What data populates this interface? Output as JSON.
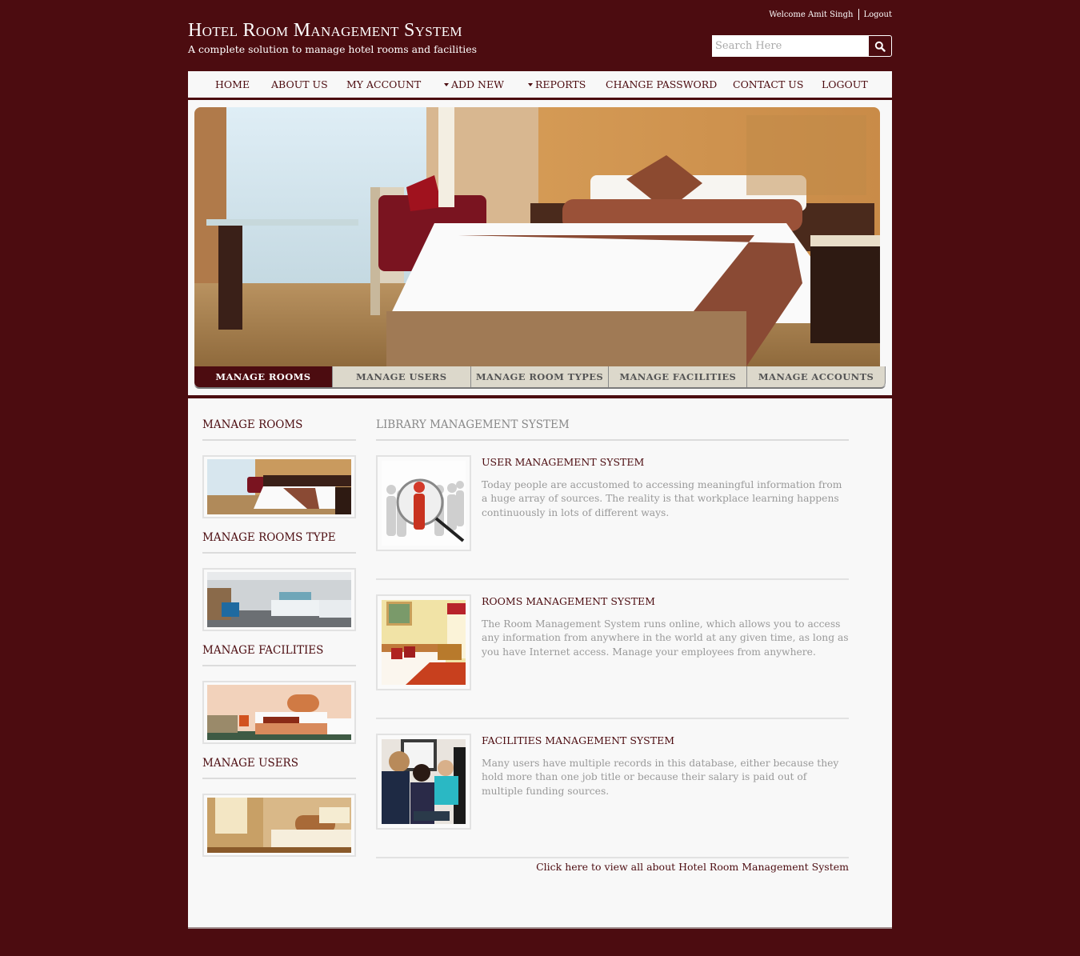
{
  "header": {
    "title": "Hotel Room Management System",
    "subtitle": "A complete solution to manage hotel rooms and facilities",
    "welcome": "Welcome Amit Singh",
    "logout": "Logout",
    "search_placeholder": "Search Here",
    "search_icon": "search-icon"
  },
  "nav": {
    "items": [
      {
        "label": "HOME",
        "dropdown": false
      },
      {
        "label": "ABOUT US",
        "dropdown": false
      },
      {
        "label": "MY ACCOUNT",
        "dropdown": false
      },
      {
        "label": "ADD NEW",
        "dropdown": true
      },
      {
        "label": "REPORTS",
        "dropdown": true
      },
      {
        "label": "CHANGE PASSWORD",
        "dropdown": false
      },
      {
        "label": "CONTACT US",
        "dropdown": false
      },
      {
        "label": "LOGOUT",
        "dropdown": false
      }
    ]
  },
  "hero": {
    "image": "hotel-room-photo",
    "tabs": [
      {
        "label": "MANAGE ROOMS",
        "active": true
      },
      {
        "label": "MANAGE USERS",
        "active": false
      },
      {
        "label": "MANAGE ROOM TYPES",
        "active": false
      },
      {
        "label": "MANAGE FACILITIES",
        "active": false
      },
      {
        "label": "MANAGE ACCOUNTS",
        "active": false
      }
    ]
  },
  "sidebar": {
    "sections": [
      {
        "heading": "MANAGE ROOMS",
        "image": "hotel-room-thumbnail"
      },
      {
        "heading": "MANAGE ROOMS TYPE",
        "image": "room-type-thumbnail"
      },
      {
        "heading": "MANAGE FACILITIES",
        "image": "facilities-thumbnail"
      },
      {
        "heading": "MANAGE USERS",
        "image": "users-thumbnail"
      }
    ]
  },
  "main": {
    "heading": "LIBRARY MANAGEMENT SYSTEM",
    "items": [
      {
        "title": "USER MANAGEMENT SYSTEM",
        "text": "Today people are accustomed to accessing meaningful information from a huge array of sources. The reality is that workplace learning happens continuously in lots of different ways.",
        "image": "user-search-magnifier-image"
      },
      {
        "title": "ROOMS MANAGEMENT SYSTEM",
        "text": "The Room Management System runs online, which allows you to access any information from anywhere in the world at any given time, as long as you have Internet access. Manage your employees from anywhere.",
        "image": "hotel-bedroom-image"
      },
      {
        "title": "FACILITIES MANAGEMENT SYSTEM",
        "text": "Many users have multiple records in this database, either because they hold more than one job title or because their salary is paid out of multiple funding sources.",
        "image": "people-at-computer-image"
      }
    ],
    "more_link": "Click here to view all about Hotel Room Management System"
  },
  "colors": {
    "brand": "#4c0c10",
    "panel": "#f8f8f8",
    "tab_inactive": "#dcd8cb",
    "muted_text": "#999999"
  }
}
